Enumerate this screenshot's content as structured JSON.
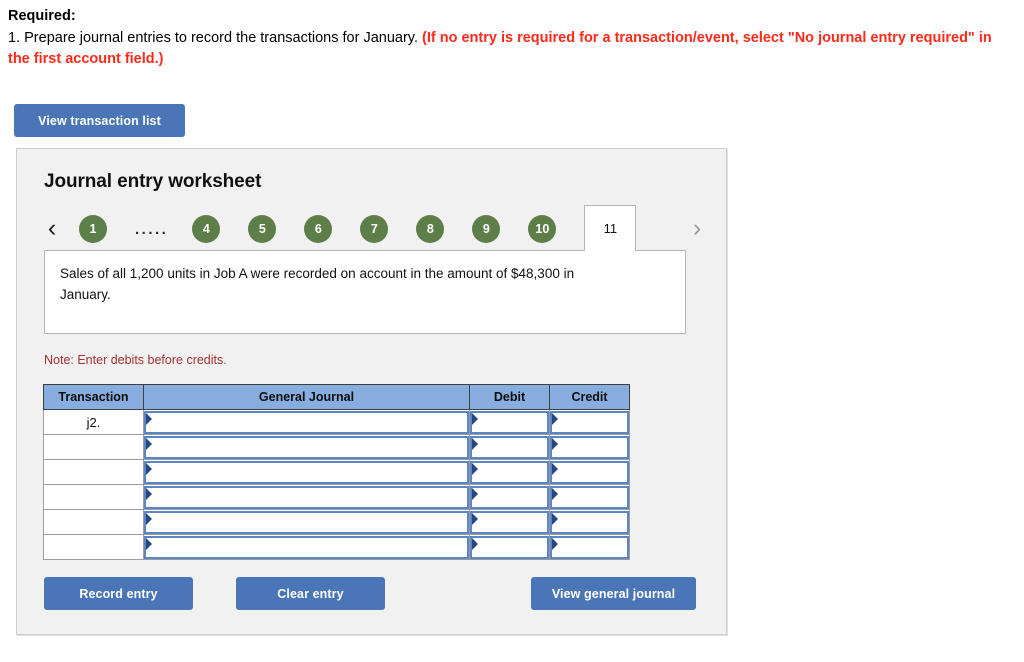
{
  "instructions": {
    "heading": "Required:",
    "item_number": "1.",
    "item_text": "Prepare journal entries to record the transactions for January.",
    "item_note_red": "(If no entry is required for a transaction/event, select \"No journal entry required\" in the first account field.)"
  },
  "toolbar": {
    "view_transaction_list_label": "View transaction list"
  },
  "worksheet": {
    "title": "Journal entry worksheet",
    "pagination": {
      "prev_icon": "chevron-left-icon",
      "next_icon": "chevron-right-icon",
      "ellipsis": ".....",
      "pages": [
        "1",
        "4",
        "5",
        "6",
        "7",
        "8",
        "9",
        "10"
      ],
      "current_page": "11"
    },
    "description": "Sales of all 1,200 units in Job A were recorded on account in the amount of $48,300 in January.",
    "note": "Note: Enter debits before credits.",
    "table": {
      "headers": [
        "Transaction",
        "General Journal",
        "Debit",
        "Credit"
      ],
      "rows": [
        {
          "transaction": "j2.",
          "general_journal": "",
          "debit": "",
          "credit": ""
        },
        {
          "transaction": "",
          "general_journal": "",
          "debit": "",
          "credit": ""
        },
        {
          "transaction": "",
          "general_journal": "",
          "debit": "",
          "credit": ""
        },
        {
          "transaction": "",
          "general_journal": "",
          "debit": "",
          "credit": ""
        },
        {
          "transaction": "",
          "general_journal": "",
          "debit": "",
          "credit": ""
        },
        {
          "transaction": "",
          "general_journal": "",
          "debit": "",
          "credit": ""
        }
      ]
    },
    "actions": {
      "record_entry_label": "Record entry",
      "clear_entry_label": "Clear entry",
      "view_general_journal_label": "View general journal"
    }
  },
  "colors": {
    "button_blue": "#4a76b8",
    "table_header_blue": "#87aede",
    "pager_green": "#5c7f49",
    "alert_red": "#ff2a18",
    "note_red": "#a83232",
    "panel_gray": "#f1f1f1"
  }
}
